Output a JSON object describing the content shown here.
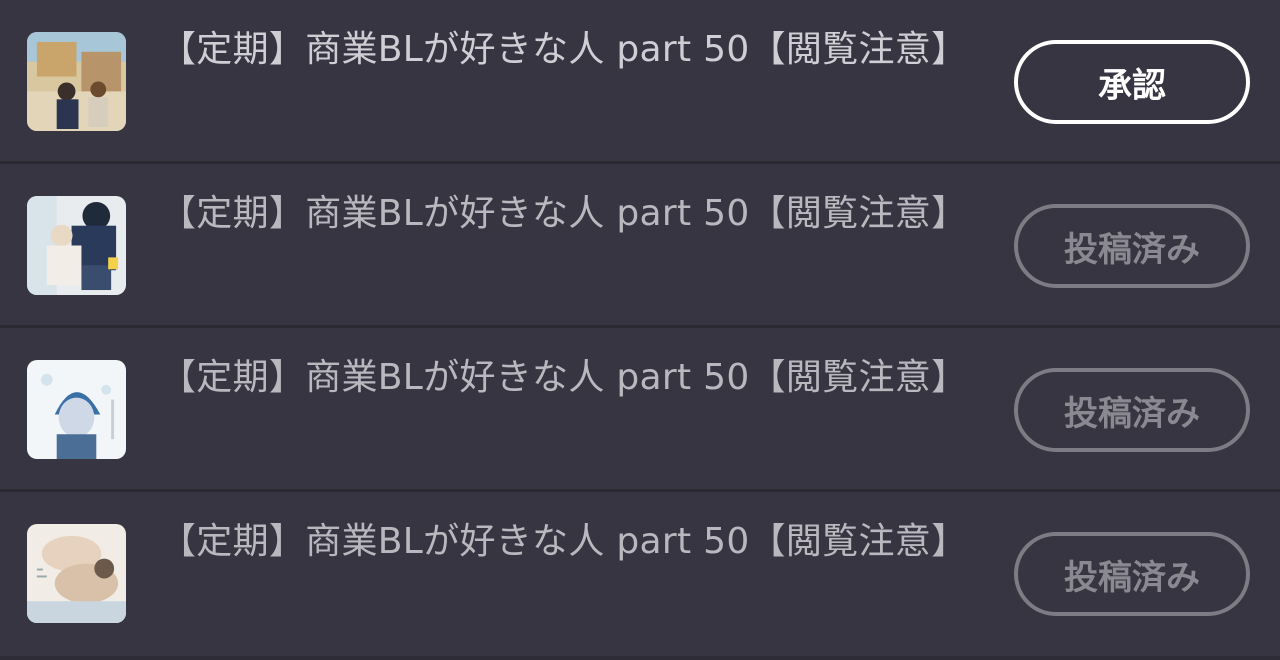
{
  "items": [
    {
      "title": "【定期】商業BLが好きな人 part 50【閲覧注意】",
      "thumbnail": "manga-cover-thumbnail",
      "button_label": "承認",
      "button_state": "approve"
    },
    {
      "title": "【定期】商業BLが好きな人 part 50【閲覧注意】",
      "thumbnail": "manga-cover-thumbnail",
      "button_label": "投稿済み",
      "button_state": "posted"
    },
    {
      "title": "【定期】商業BLが好きな人 part 50【閲覧注意】",
      "thumbnail": "manga-cover-thumbnail",
      "button_label": "投稿済み",
      "button_state": "posted"
    },
    {
      "title": "【定期】商業BLが好きな人 part 50【閲覧注意】",
      "thumbnail": "manga-cover-thumbnail",
      "button_label": "投稿済み",
      "button_state": "posted"
    }
  ],
  "colors": {
    "background": "#363541",
    "divider": "#2b2a33",
    "title_text": "#b9b8bf",
    "approve_border": "#ffffff",
    "posted_border": "#7d7c84"
  }
}
